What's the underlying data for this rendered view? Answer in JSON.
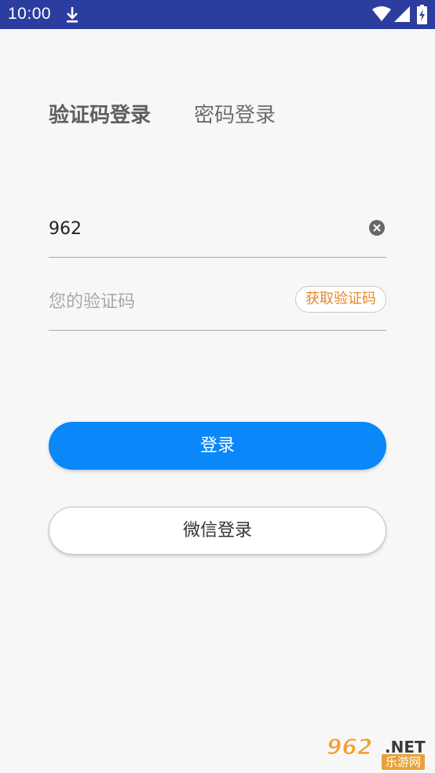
{
  "status_bar": {
    "time": "10:00",
    "background_color": "#2b3d9e",
    "icons": [
      "download-icon",
      "wifi-icon",
      "signal-icon",
      "battery-charging-icon"
    ]
  },
  "tabs": {
    "active_label": "验证码登录",
    "inactive_label": "密码登录"
  },
  "phone_field": {
    "value": "962",
    "clear_icon": "clear-icon"
  },
  "code_field": {
    "placeholder": "您的验证码",
    "value": "",
    "get_code_label": "获取验证码",
    "get_code_color": "#e8872b"
  },
  "buttons": {
    "login_label": "登录",
    "login_color": "#0a87f9",
    "wechat_label": "微信登录"
  },
  "watermark": {
    "main": "962",
    "domain": ".NET",
    "subtitle": "乐游网"
  }
}
